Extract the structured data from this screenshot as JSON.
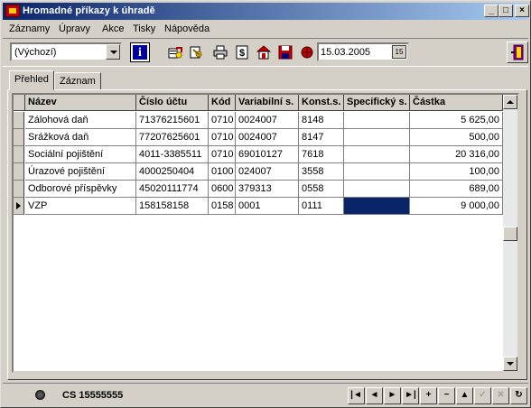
{
  "window": {
    "title": "Hromadné příkazy k úhradě",
    "controls": [
      "_",
      "□",
      "×"
    ]
  },
  "menu": [
    "Záznamy",
    "Úpravy",
    "Akce",
    "Tisky",
    "Nápověda"
  ],
  "toolbar": {
    "filter_value": "(Výchozí)",
    "date_value": "15.03.2005",
    "calendar_label": "15"
  },
  "tabs": [
    "Přehled",
    "Záznam"
  ],
  "table": {
    "columns": [
      "Název",
      "Číslo účtu",
      "Kód",
      "Variabilní s.",
      "Konst.s.",
      "Specifický s.",
      "Částka"
    ],
    "rows": [
      [
        "Zálohová daň",
        "71376215601",
        "0710",
        "0024007",
        "8148",
        "",
        "5 625,00"
      ],
      [
        "Srážková daň",
        "77207625601",
        "0710",
        "0024007",
        "8147",
        "",
        "500,00"
      ],
      [
        "Sociální pojištění",
        "4011-3385511",
        "0710",
        "69010127",
        "7618",
        "",
        "20 316,00"
      ],
      [
        "Úrazové pojištění",
        "4000250404",
        "0100",
        "024007",
        "3558",
        "",
        "100,00"
      ],
      [
        "Odborové příspěvky",
        "45020111774",
        "0600",
        "379313",
        "0558",
        "",
        "689,00"
      ],
      [
        "VZP",
        "158158158",
        "0158",
        "0001",
        "0111",
        "",
        "9 000,00"
      ]
    ]
  },
  "status": {
    "text": "CS 15555555"
  },
  "nav_buttons": [
    "|◄",
    "◄",
    "►",
    "►|",
    "+",
    "−",
    "▲",
    "✓",
    "✕",
    "↻"
  ]
}
